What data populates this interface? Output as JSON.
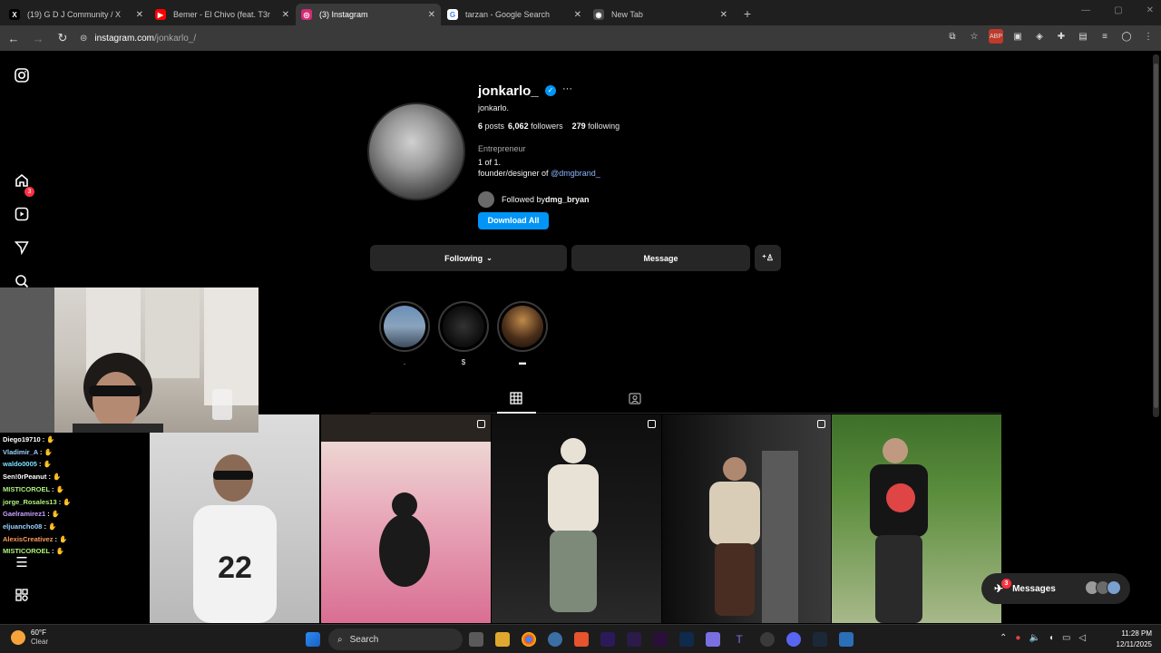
{
  "browser": {
    "tabs": [
      {
        "title": "(19) G D J Community / X",
        "fav": "X",
        "fav_color": "#000000",
        "active": false
      },
      {
        "title": "Bemer - El Chivo (feat. T3r",
        "fav": "▶",
        "fav_color": "#ff0000",
        "active": false
      },
      {
        "title": "(3) Instagram",
        "fav": "◎",
        "fav_color": "#d62976",
        "active": true
      },
      {
        "title": "tarzan - Google Search",
        "fav": "G",
        "fav_color": "#ffffff",
        "active": false
      },
      {
        "title": "New Tab",
        "fav": "◉",
        "fav_color": "#4a4a4a",
        "active": false
      }
    ],
    "url_domain": "instagram.com",
    "url_path": "/jonkarlo_/"
  },
  "profile": {
    "username": "jonkarlo_",
    "fullname": "jonkarlo.",
    "posts_count": "6",
    "posts_label": "posts",
    "followers_count": "6,062",
    "followers_label": "followers",
    "following_count": "279",
    "following_label": "following",
    "category": "Entrepreneur",
    "bio_line1": "1 of 1.",
    "bio_line2_prefix": "founder/designer of ",
    "bio_link": "@dmgbrand_",
    "followed_by_prefix": "Followed by ",
    "followed_by_user": "dmg_bryan",
    "download_label": "Download All",
    "following_btn": "Following",
    "message_btn": "Message"
  },
  "highlights": [
    {
      "label": ".",
      "color": "#5a7fa8"
    },
    {
      "label": "$",
      "color": "#2a2a2a"
    },
    {
      "label": "▬",
      "color": "#6b4a2e"
    }
  ],
  "chat": [
    {
      "user": "Diego19710",
      "color": "#ffffff"
    },
    {
      "user": "Vladimir_A",
      "color": "#9ad1ff"
    },
    {
      "user": "waldo0005",
      "color": "#7ee0ff"
    },
    {
      "user": "Sen!0rPeanut",
      "color": "#ffffff"
    },
    {
      "user": "MISTICOROEL",
      "color": "#aef27a"
    },
    {
      "user": "jorge_Rosales13",
      "color": "#aef27a"
    },
    {
      "user": "Gaelramirez1",
      "color": "#c9a2ff"
    },
    {
      "user": "eljuancho08",
      "color": "#9ad1ff"
    },
    {
      "user": "AlexisCreativez",
      "color": "#ff9a5a"
    },
    {
      "user": "MISTICOROEL",
      "color": "#aef27a"
    }
  ],
  "messages": {
    "label": "Messages",
    "badge": "3"
  },
  "nav": {
    "notif_badge": "3"
  },
  "taskbar": {
    "temp": "60°F",
    "weather": "Clear",
    "search": "Search",
    "time": "11:28 PM",
    "date": "12/11/2025"
  },
  "colors": {
    "accent": "#0095f6",
    "badge": "#ff3040"
  }
}
